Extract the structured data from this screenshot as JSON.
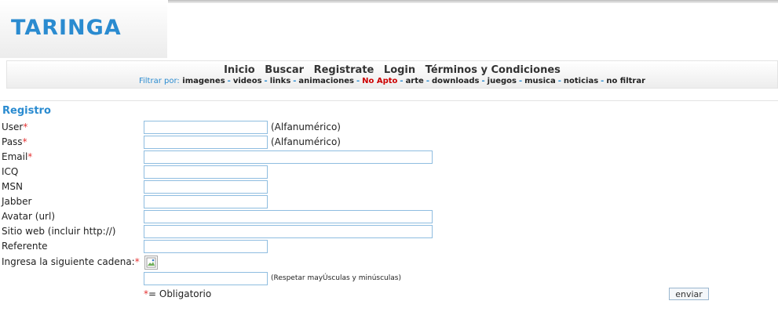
{
  "brand": {
    "logo_text": "TARINGA",
    "color": "#2a8bd0"
  },
  "nav": {
    "items": [
      "Inicio",
      "Buscar",
      "Registrate",
      "Login",
      "Términos y Condiciones"
    ],
    "filter_label": "Filtrar por:",
    "filters": [
      "imagenes",
      "videos",
      "links",
      "animaciones",
      "No Apto",
      "arte",
      "downloads",
      "juegos",
      "musica",
      "noticias",
      "no filtrar"
    ],
    "separator": "-"
  },
  "form": {
    "title": "Registro",
    "required_mark": "*",
    "fields": {
      "user": {
        "label": "User",
        "hint": "(Alfanumérico)",
        "value": ""
      },
      "pass": {
        "label": "Pass",
        "hint": "(Alfanumérico)",
        "value": ""
      },
      "email": {
        "label": "Email",
        "value": ""
      },
      "icq": {
        "label": "ICQ",
        "value": ""
      },
      "msn": {
        "label": "MSN",
        "value": ""
      },
      "jabber": {
        "label": "Jabber",
        "value": ""
      },
      "avatar": {
        "label": "Avatar (url)",
        "value": ""
      },
      "website": {
        "label": "Sitio web (incluir http://)",
        "value": ""
      },
      "referrer": {
        "label": "Referente",
        "value": ""
      },
      "captcha": {
        "label": "Ingresa la siguiente cadena:",
        "hint": "(Respetar mayÚsculas y minúsculas)",
        "value": ""
      }
    },
    "required_note": "= Obligatorio",
    "submit_label": "enviar"
  },
  "colors": {
    "required": "#e53333",
    "no_apto": "#cc0000",
    "input_border": "#8fbde0"
  }
}
